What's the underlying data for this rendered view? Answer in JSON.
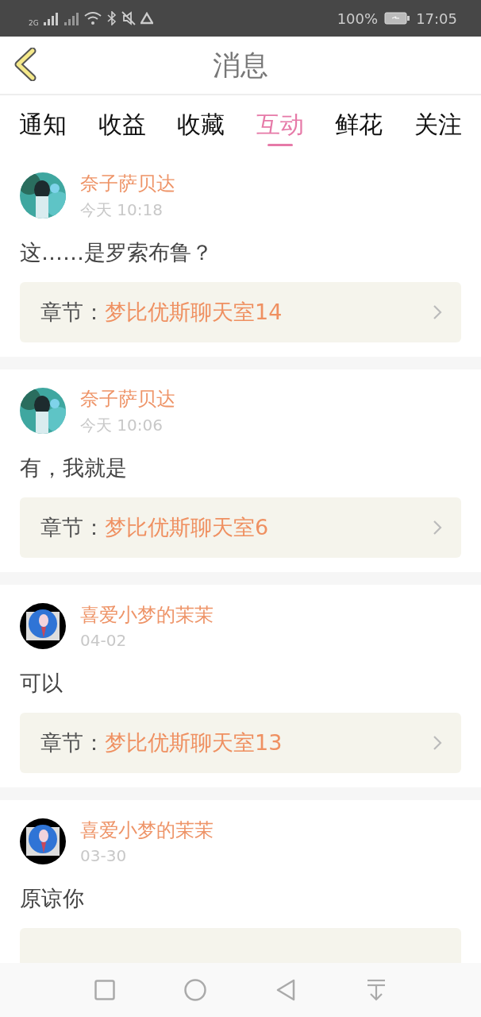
{
  "status_bar": {
    "network": "2G",
    "battery": "100%",
    "time": "17:05"
  },
  "header": {
    "title": "消息"
  },
  "tabs": [
    {
      "label": "通知",
      "selected": false
    },
    {
      "label": "收益",
      "selected": false
    },
    {
      "label": "收藏",
      "selected": false
    },
    {
      "label": "互动",
      "selected": true
    },
    {
      "label": "鲜花",
      "selected": false
    },
    {
      "label": "关注",
      "selected": false
    }
  ],
  "messages": [
    {
      "user": "奈子萨贝达",
      "time": "今天 10:18",
      "text": "这……是罗索布鲁？",
      "chapter_label": "章节：",
      "chapter": "梦比优斯聊天室14"
    },
    {
      "user": "奈子萨贝达",
      "time": "今天 10:06",
      "text": "有，我就是",
      "chapter_label": "章节：",
      "chapter": "梦比优斯聊天室6"
    },
    {
      "user": "喜爱小梦的茉茉",
      "time": "04-02",
      "text": "可以",
      "chapter_label": "章节：",
      "chapter": "梦比优斯聊天室13"
    },
    {
      "user": "喜爱小梦的茉茉",
      "time": "03-30",
      "text": "原谅你"
    }
  ]
}
